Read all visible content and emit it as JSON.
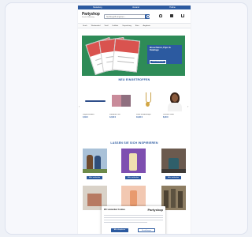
{
  "page": {
    "bg": "#eef1f7",
    "accent": "#2c5aa0"
  },
  "topbar": {
    "items": [
      "Bestellung",
      "Versand",
      "Hotline"
    ]
  },
  "header": {
    "logo_name": "Partyshop",
    "logo_sub": "Druck & Werbung",
    "search_placeholder": "Suchbegriff eingeben...",
    "icons": [
      {
        "icon": "user-icon",
        "label": "Konto"
      },
      {
        "icon": "bag-icon",
        "label": "Merkliste"
      },
      {
        "icon": "cart-icon",
        "label": "Warenkorb"
      }
    ]
  },
  "nav": {
    "items": [
      "Druck",
      "Werbemittel",
      "Textil",
      "Schilder",
      "Verpackung",
      "Büro",
      "Angebote"
    ]
  },
  "hero": {
    "headline": "Broschüren, Flyer & Kataloge",
    "button": "Jetzt entdecken"
  },
  "sections": {
    "new_title": "NEU EINGETROFFEN",
    "inspire_title": "LASSEN SIE SICH INSPIRIEREN"
  },
  "products": [
    {
      "name": "Kugelschreiber",
      "price": "0,49 €"
    },
    {
      "name": "Fotodruck Set",
      "price": "12,90 €"
    },
    {
      "name": "Kette mit Anhänger",
      "price": "19,90 €"
    },
    {
      "name": "Portrait Poster",
      "price": "8,90 €"
    }
  ],
  "tiles": [
    {
      "label": "Mehr entdecken"
    },
    {
      "label": "Mehr entdecken"
    },
    {
      "label": "Mehr entdecken"
    }
  ],
  "consent": {
    "title": "Wir verwenden Cookies",
    "logo": "Partyshop",
    "accept": "Alle akzeptieren",
    "settings": "Einstellungen"
  }
}
